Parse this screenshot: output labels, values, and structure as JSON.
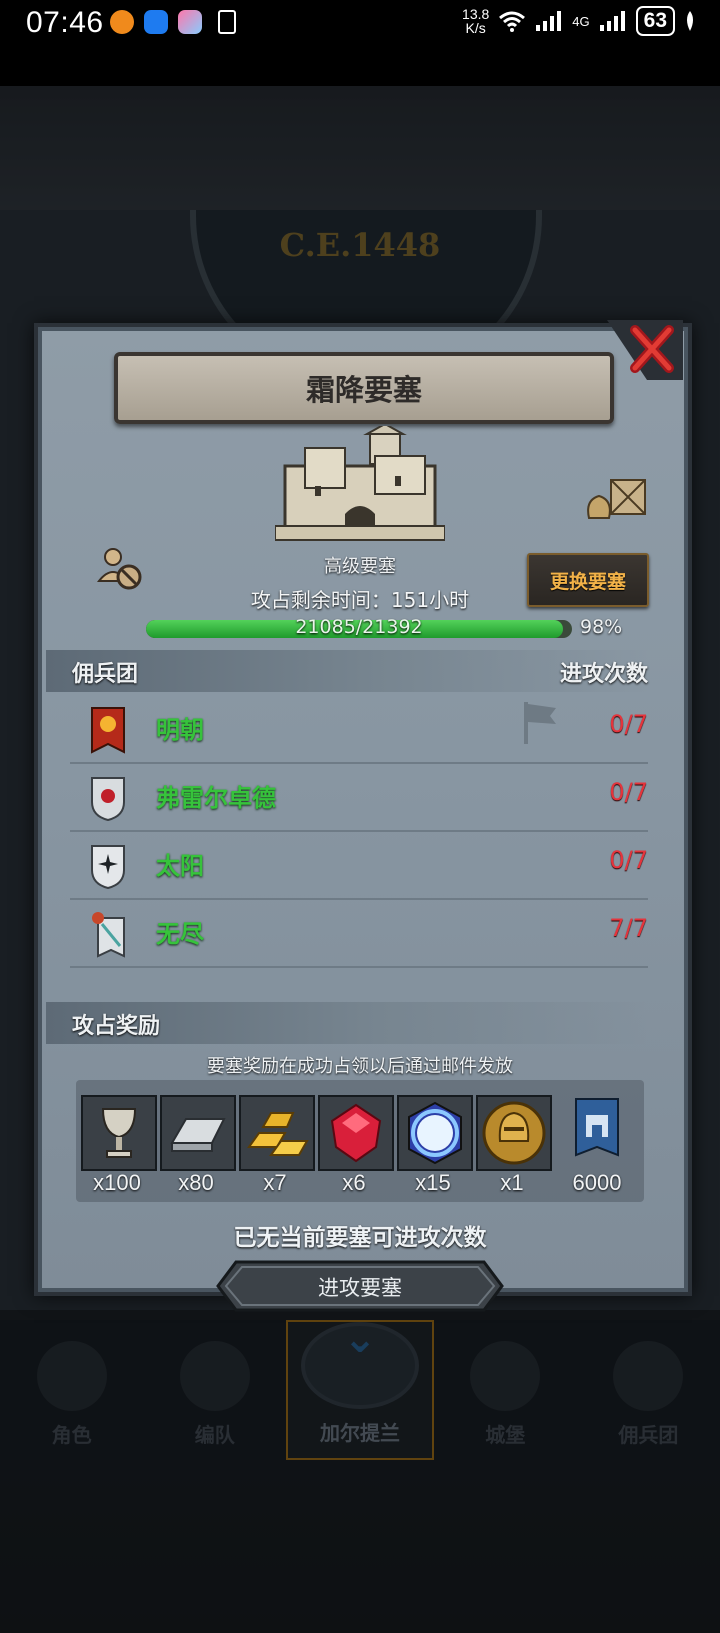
{
  "status_bar": {
    "time": "07:46",
    "net_speed_value": "13.8",
    "net_speed_unit": "K/s",
    "network": "4G",
    "battery": "63"
  },
  "background": {
    "era_label": "C.E.1448"
  },
  "fortress": {
    "title": "霜降要塞",
    "tier": "高级要塞",
    "swap_button": "更换要塞",
    "time_left_label": "攻占剩余时间：",
    "time_left_value": "151",
    "time_left_unit": "小时",
    "hp_text": "21085/21392",
    "hp_fraction": 0.98,
    "hp_percent": "98%"
  },
  "mercenaries": {
    "header_left": "佣兵团",
    "header_right": "进攻次数",
    "rows": [
      {
        "name": "明朝",
        "count": "0/7"
      },
      {
        "name": "弗雷尔卓德",
        "count": "0/7"
      },
      {
        "name": "太阳",
        "count": "0/7"
      },
      {
        "name": "无尽",
        "count": "7/7"
      }
    ]
  },
  "rewards": {
    "header": "攻占奖励",
    "note": "要塞奖励在成功占领以后通过邮件发放",
    "items": [
      {
        "icon": "chalice-icon",
        "qty": "x100"
      },
      {
        "icon": "iron-ingot-icon",
        "qty": "x80"
      },
      {
        "icon": "gold-bars-icon",
        "qty": "x7"
      },
      {
        "icon": "ruby-icon",
        "qty": "x6"
      },
      {
        "icon": "crystal-orb-icon",
        "qty": "x15"
      },
      {
        "icon": "knight-helmet-coin-icon",
        "qty": "x1"
      },
      {
        "icon": "castle-banner-icon",
        "qty": "6000"
      }
    ]
  },
  "footer": {
    "no_attempts": "已无当前要塞可进攻次数",
    "attack_button": "进攻要塞"
  },
  "bottom_nav": {
    "items": [
      {
        "label": "角色"
      },
      {
        "label": "编队"
      },
      {
        "label": "加尔提兰"
      },
      {
        "label": "城堡"
      },
      {
        "label": "佣兵团"
      }
    ]
  },
  "colors": {
    "ally_name": "#36c33b",
    "attempt_count": "#e4343c",
    "swap_text": "#f2b248",
    "hp_fill": "#2fb53a"
  }
}
